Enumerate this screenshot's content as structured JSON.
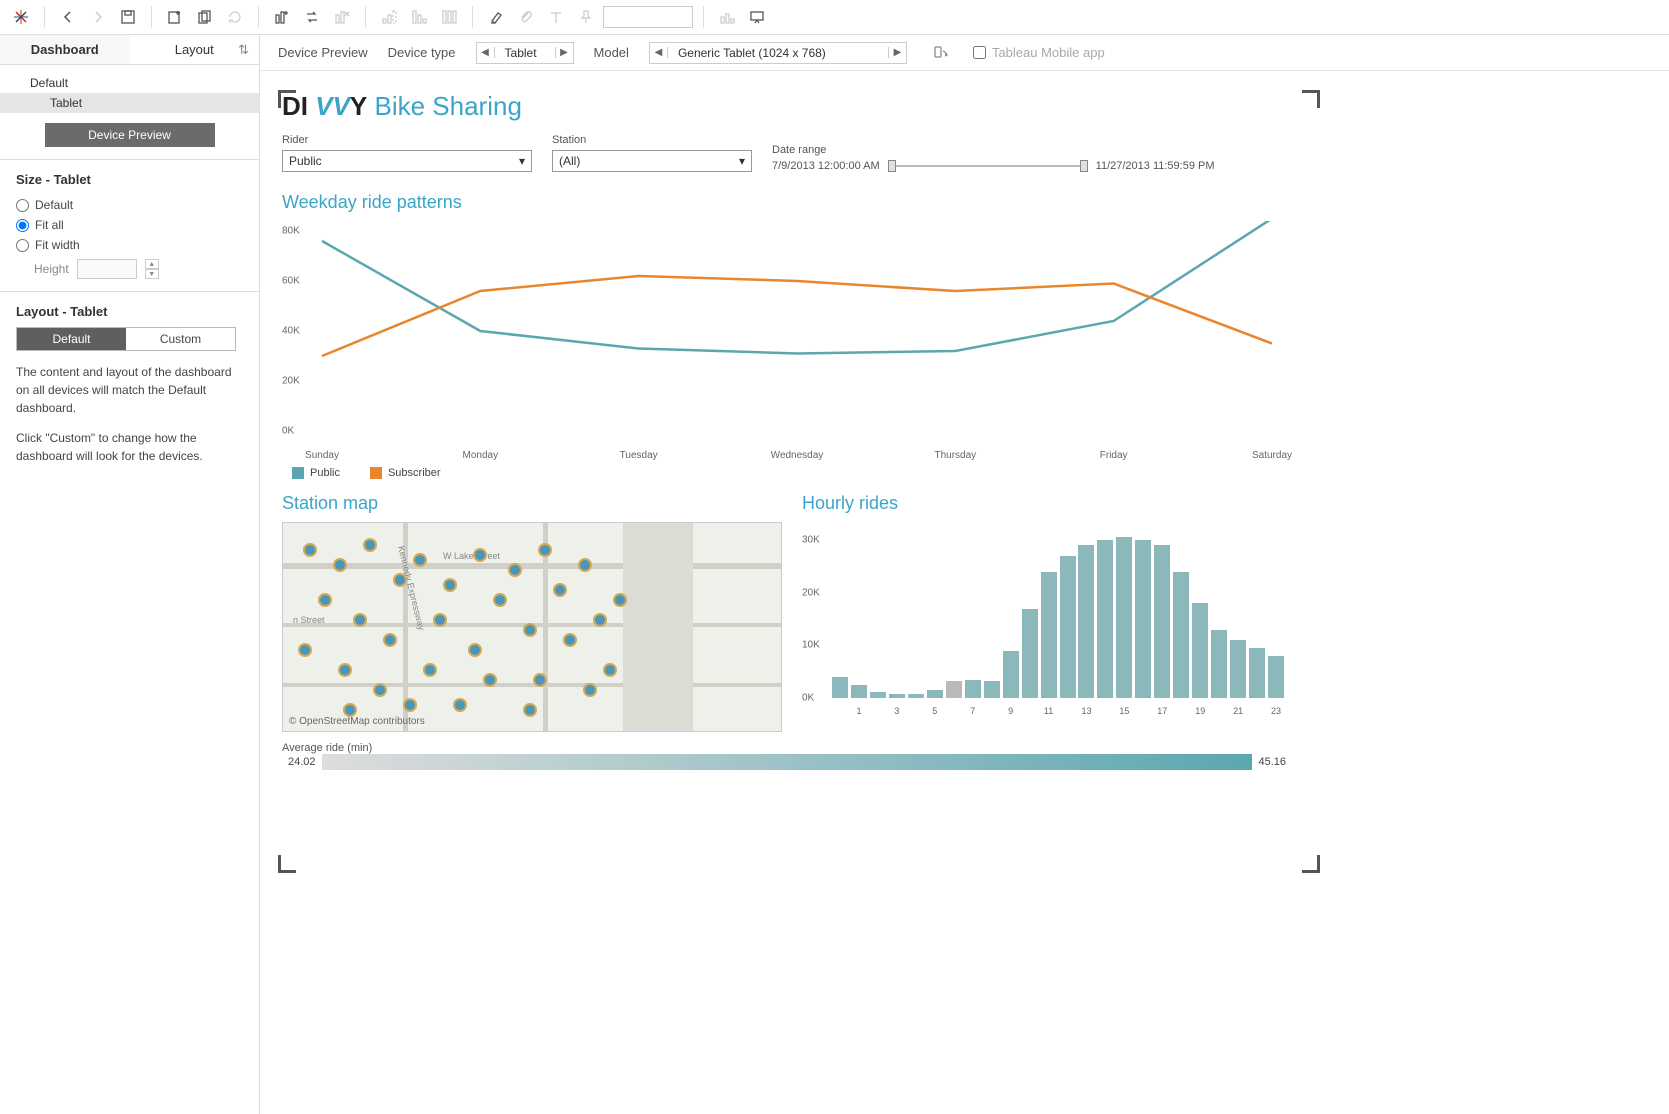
{
  "toolbar": {
    "search_box": ""
  },
  "sidebar": {
    "tabs": {
      "dashboard": "Dashboard",
      "layout": "Layout"
    },
    "device_tree": {
      "default": "Default",
      "tablet": "Tablet"
    },
    "preview_btn": "Device Preview",
    "size": {
      "heading": "Size - Tablet",
      "opts": {
        "default": "Default",
        "fit_all": "Fit all",
        "fit_width": "Fit width"
      },
      "height_lbl": "Height"
    },
    "layout": {
      "heading": "Layout - Tablet",
      "default": "Default",
      "custom": "Custom",
      "help1": "The content and layout of the dashboard on all devices will match the Default dashboard.",
      "help2": "Click \"Custom\" to change how the dashboard will look for the devices."
    }
  },
  "preview_bar": {
    "device_preview": "Device Preview",
    "device_type_lbl": "Device type",
    "device_type": "Tablet",
    "model_lbl": "Model",
    "model": "Generic Tablet (1024 x 768)",
    "mobile_app": "Tableau Mobile app"
  },
  "dash": {
    "title": {
      "di": "DI",
      "vvy": " VV",
      "y": "Y",
      "sub": " Bike Sharing"
    },
    "filters": {
      "rider_lbl": "Rider",
      "rider": "Public",
      "station_lbl": "Station",
      "station": "(All)",
      "date_range_lbl": "Date range",
      "date_from": "7/9/2013 12:00:00 AM",
      "date_to": "11/27/2013 11:59:59 PM"
    },
    "weekday_title": "Weekday ride patterns",
    "legend": {
      "public": "Public",
      "subscriber": "Subscriber"
    },
    "map_title": "Station map",
    "map_credit": "© OpenStreetMap contributors",
    "hourly_title": "Hourly rides",
    "avg_label": "Average ride (min)",
    "avg_min": "24.02",
    "avg_max": "45.16"
  },
  "chart_data": [
    {
      "type": "line",
      "title": "Weekday ride patterns",
      "categories": [
        "Sunday",
        "Monday",
        "Tuesday",
        "Wednesday",
        "Thursday",
        "Friday",
        "Saturday"
      ],
      "series": [
        {
          "name": "Public",
          "color": "#5ba7b0",
          "values": [
            76000,
            40000,
            33000,
            31000,
            32000,
            44000,
            85000
          ]
        },
        {
          "name": "Subscriber",
          "color": "#e8862e",
          "values": [
            30000,
            56000,
            62000,
            60000,
            56000,
            59000,
            35000
          ]
        }
      ],
      "ylim": [
        0,
        80000
      ],
      "yticks": [
        0,
        20000,
        40000,
        60000,
        80000
      ],
      "ytick_labels": [
        "0K",
        "20K",
        "40K",
        "60K",
        "80K"
      ]
    },
    {
      "type": "bar",
      "title": "Hourly rides",
      "x": [
        0,
        1,
        2,
        3,
        4,
        5,
        6,
        7,
        8,
        9,
        10,
        11,
        12,
        13,
        14,
        15,
        16,
        17,
        18,
        19,
        20,
        21,
        22,
        23
      ],
      "values": [
        4000,
        2500,
        1200,
        800,
        800,
        1500,
        3300,
        3500,
        3200,
        9000,
        17000,
        24000,
        27000,
        29000,
        30000,
        30500,
        30000,
        29000,
        24000,
        18000,
        13000,
        11000,
        9500,
        8000
      ],
      "highlight_index": 6,
      "ylim": [
        0,
        30000
      ],
      "yticks": [
        0,
        10000,
        20000,
        30000
      ],
      "ytick_labels": [
        "0K",
        "10K",
        "20K",
        "30K"
      ]
    }
  ]
}
